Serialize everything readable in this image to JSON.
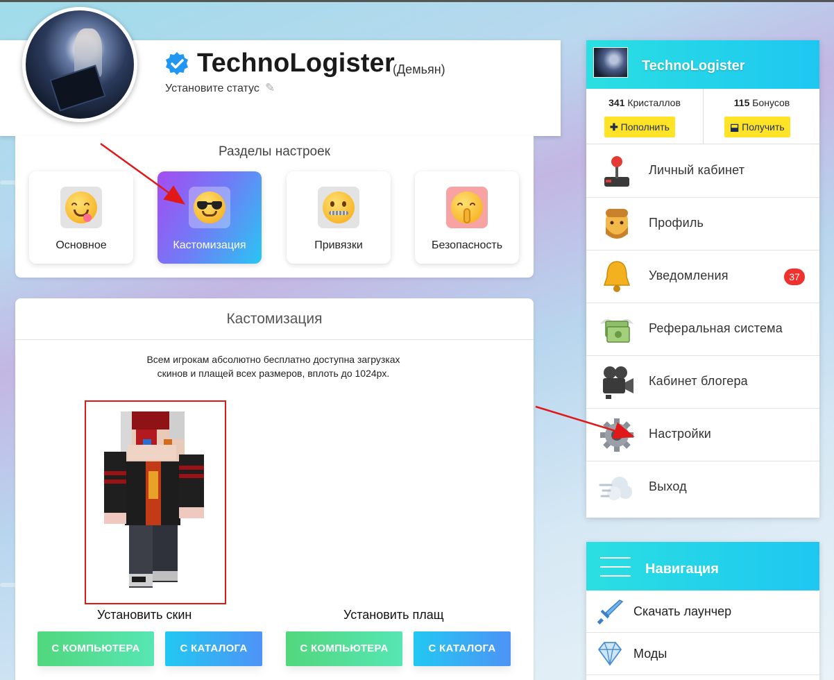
{
  "profile": {
    "username": "TechnoLogister",
    "real_name": "(Демьян)",
    "status_placeholder": "Установите статус"
  },
  "settings": {
    "title": "Разделы настроек",
    "tabs": [
      {
        "label": "Основное",
        "icon": "yum-face-icon"
      },
      {
        "label": "Кастомизация",
        "icon": "sunglasses-face-icon",
        "active": true
      },
      {
        "label": "Привязки",
        "icon": "zipper-mouth-face-icon"
      },
      {
        "label": "Безопасность",
        "icon": "shushing-face-icon"
      }
    ]
  },
  "customization": {
    "title": "Кастомизация",
    "description_line1": "Всем игрокам абсолютно бесплатно доступна загрузках",
    "description_line2": "скинов и плащей всех размеров, вплоть до 1024px.",
    "skin_label": "Установить скин",
    "cape_label": "Установить плащ",
    "btn_computer": "С КОМПЬЮТЕРА",
    "btn_catalog": "С КАТАЛОГА"
  },
  "user_panel": {
    "username": "TechnoLogister",
    "crystals_count": "341",
    "crystals_label": " Кристаллов",
    "bonuses_count": "115",
    "bonuses_label": " Бонусов",
    "topup_label": "Пополнить",
    "receive_label": "Получить",
    "menu": [
      {
        "label": "Личный кабинет",
        "icon": "joystick-icon"
      },
      {
        "label": "Профиль",
        "icon": "person-face-icon"
      },
      {
        "label": "Уведомления",
        "icon": "bell-icon",
        "badge": "37"
      },
      {
        "label": "Реферальная система",
        "icon": "money-wings-icon"
      },
      {
        "label": "Кабинет блогера",
        "icon": "movie-camera-icon"
      },
      {
        "label": "Настройки",
        "icon": "gear-icon"
      },
      {
        "label": "Выход",
        "icon": "dash-cloud-icon"
      }
    ]
  },
  "navigation": {
    "title": "Навигация",
    "items": [
      {
        "label": "Скачать лаунчер",
        "icon": "sword-icon"
      },
      {
        "label": "Моды",
        "icon": "diamond-icon"
      }
    ]
  },
  "colors": {
    "accent_cyan": "#12c4f0",
    "active_tab_start": "#a44cf2",
    "active_tab_end": "#29c6f3",
    "yellow_button": "#ffe326",
    "badge_red": "#f0322f",
    "annotation_red": "#e01818"
  }
}
